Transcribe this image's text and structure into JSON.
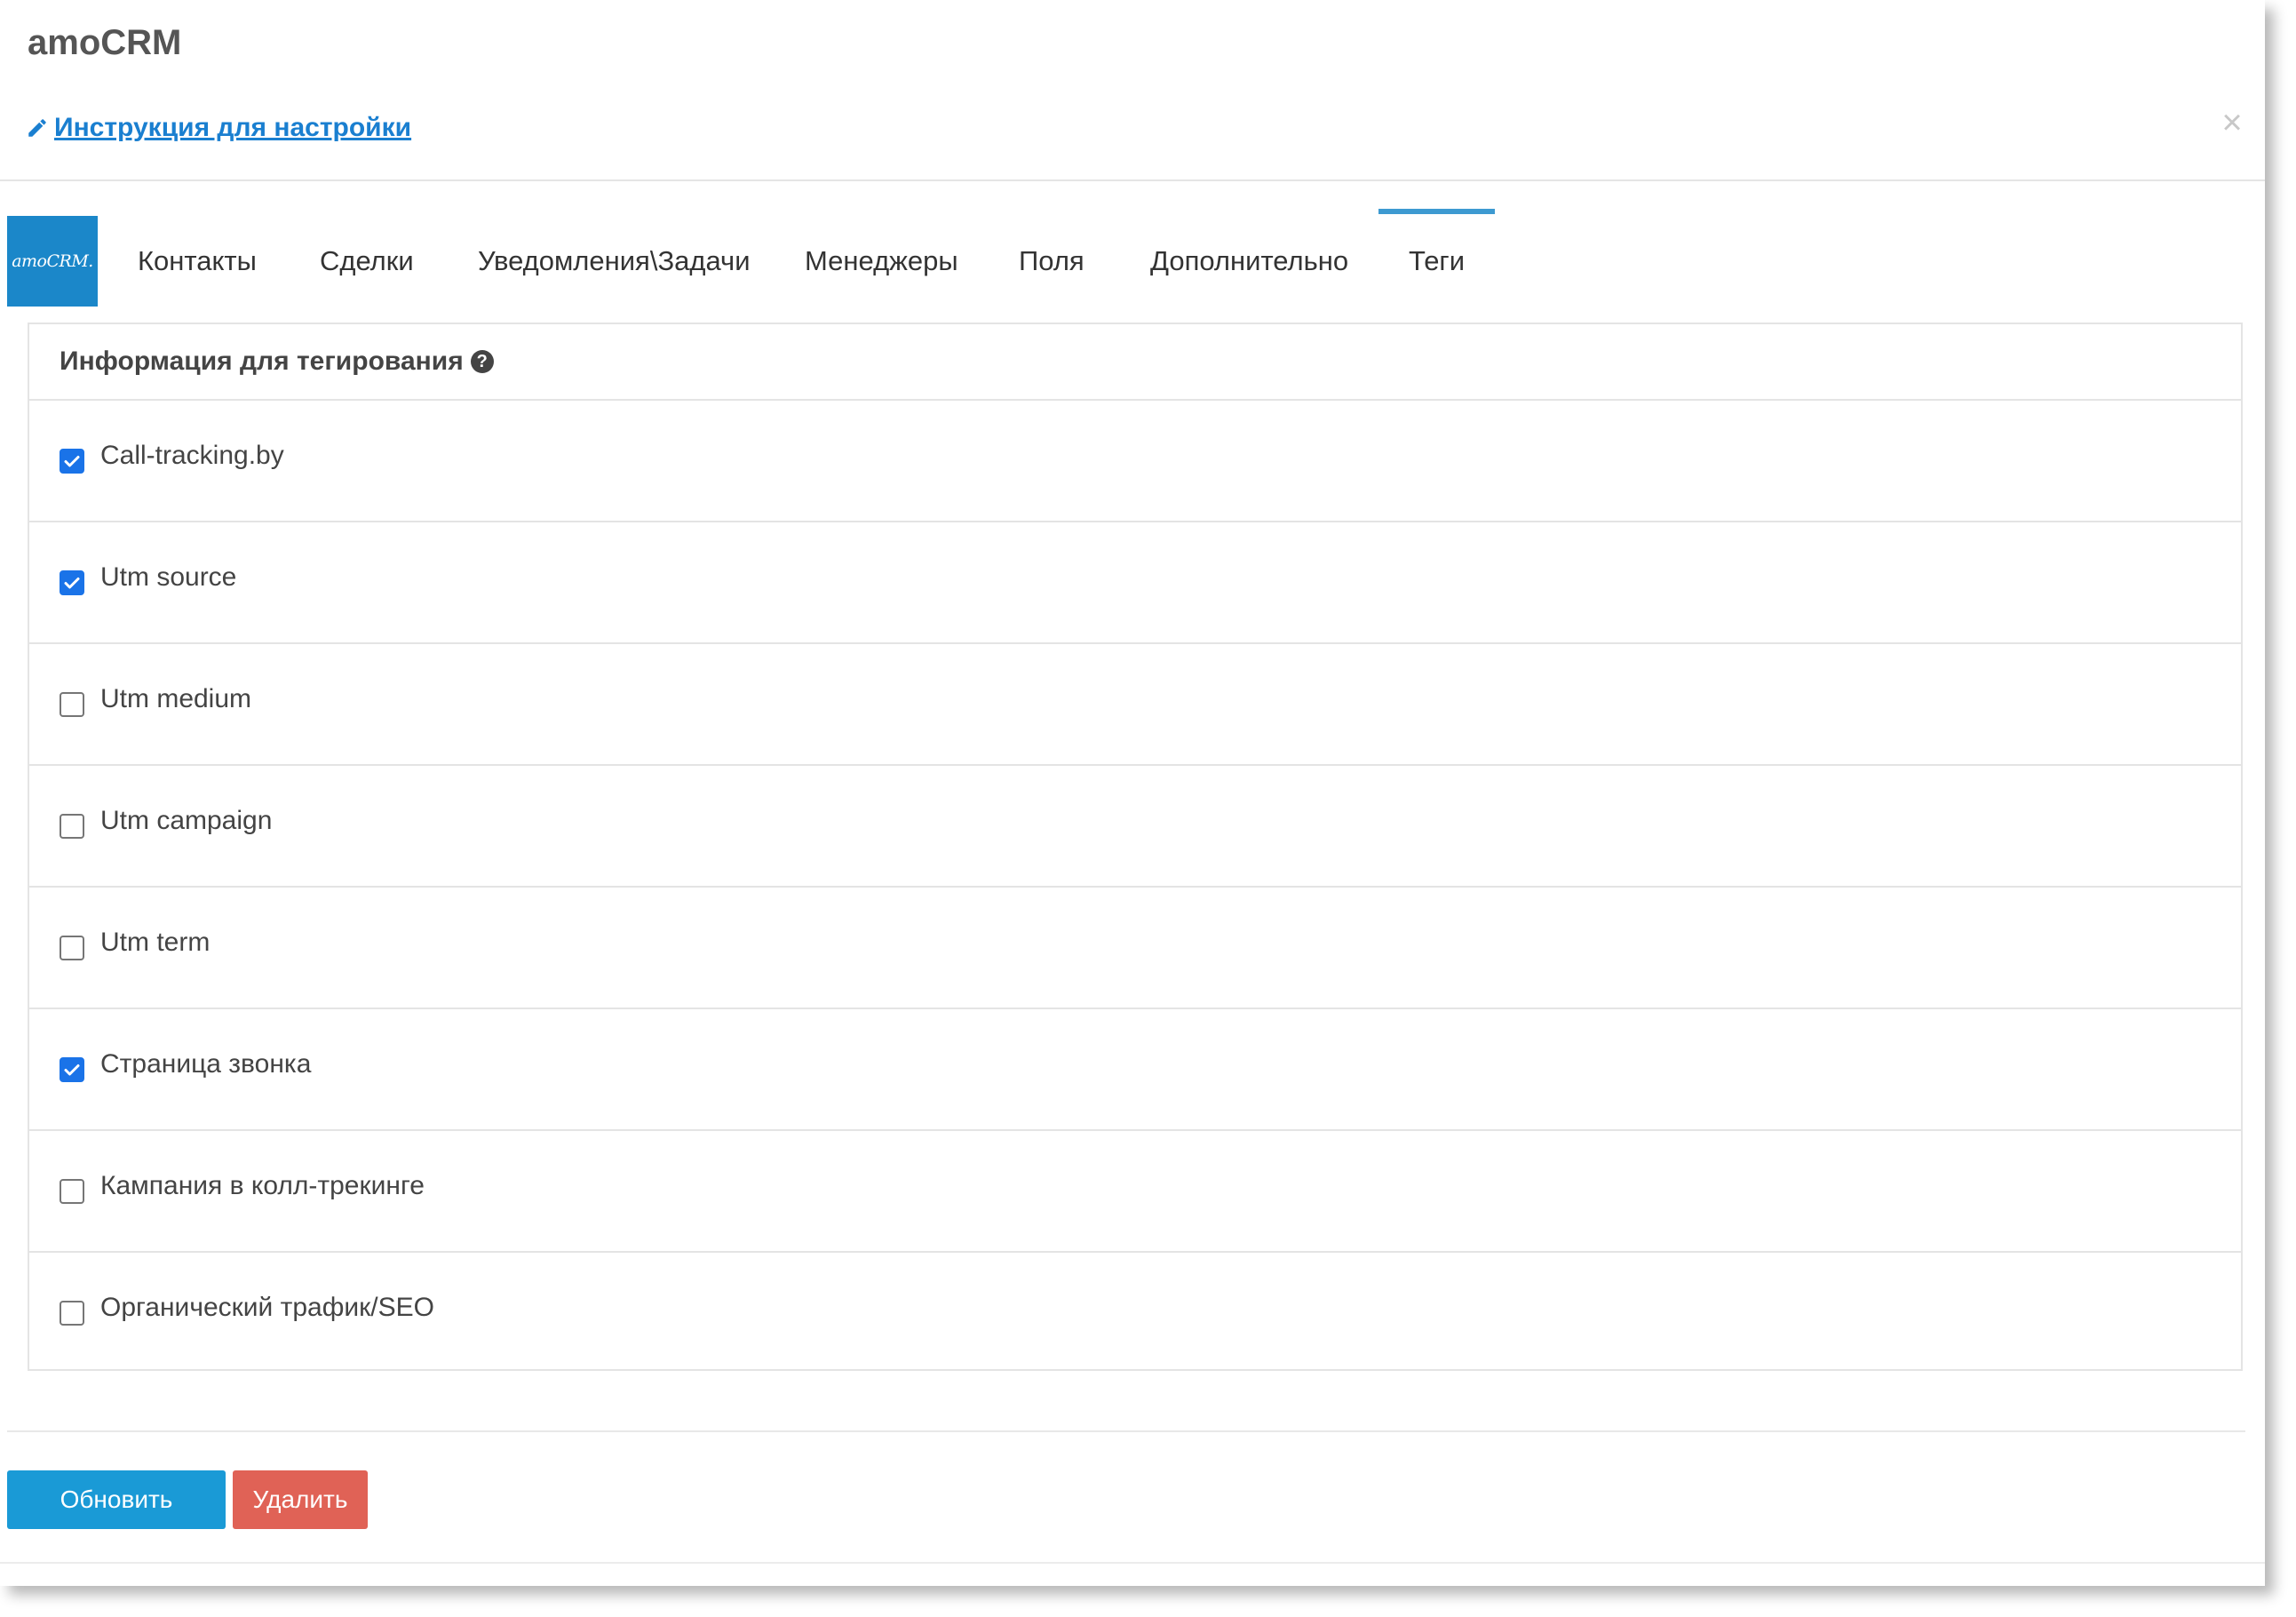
{
  "header": {
    "title": "amoCRM",
    "instruction_link": "Инструкция для настройки",
    "close_symbol": "×"
  },
  "tabs": {
    "logo_text": "amoCRM.",
    "items": [
      {
        "label": "Контакты"
      },
      {
        "label": "Сделки"
      },
      {
        "label": "Уведомления\\Задачи"
      },
      {
        "label": "Менеджеры"
      },
      {
        "label": "Поля"
      },
      {
        "label": "Дополнительно"
      },
      {
        "label": "Теги",
        "active": true
      }
    ]
  },
  "panel": {
    "heading": "Информация для тегирования",
    "help_symbol": "?",
    "options": [
      {
        "label": "Call-tracking.by",
        "checked": true
      },
      {
        "label": "Utm source",
        "checked": true
      },
      {
        "label": "Utm medium",
        "checked": false
      },
      {
        "label": "Utm campaign",
        "checked": false
      },
      {
        "label": "Utm term",
        "checked": false
      },
      {
        "label": "Страница звонка",
        "checked": true
      },
      {
        "label": "Кампания в колл-трекинге",
        "checked": false
      },
      {
        "label": "Органический трафик/SEO",
        "checked": false
      }
    ]
  },
  "footer": {
    "update_label": "Обновить",
    "delete_label": "Удалить"
  },
  "colors": {
    "accent": "#1a9ad6",
    "danger": "#e06256",
    "logo_bg": "#1b87c9",
    "link": "#1a7fd0",
    "checkbox_checked": "#1a73e8"
  }
}
